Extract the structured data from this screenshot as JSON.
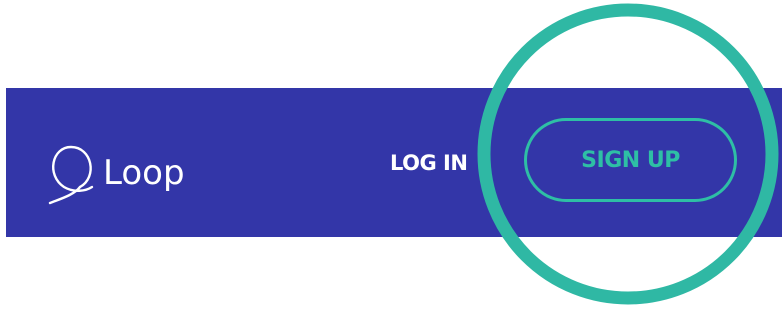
{
  "header": {
    "logo_text": "Loop",
    "logo_icon": "loop-knot-icon",
    "login_label": "LOG IN",
    "signup_label": "SIGN UP"
  },
  "colors": {
    "navbar_background": "#3336a8",
    "accent": "#2ebfa5",
    "text": "#ffffff",
    "highlight_circle": "#2fb8a4"
  }
}
